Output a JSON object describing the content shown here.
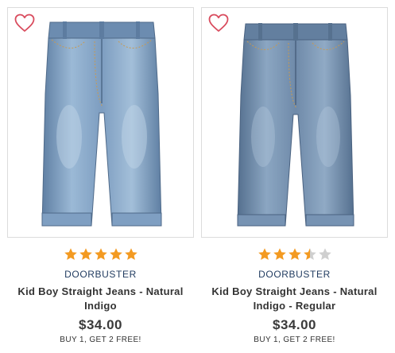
{
  "colors": {
    "heart": "#d94c5e",
    "star_filled": "#f39a21",
    "star_empty": "#cfcfcf",
    "badge_text": "#1f3a5f",
    "denim_light": "#8fb0cf",
    "denim_mid": "#6f8fb3",
    "denim_dark": "#56718f"
  },
  "products": [
    {
      "favorite_icon": "heart-outline-icon",
      "rating": 5,
      "rating_max": 5,
      "badge": "DOORBUSTER",
      "title": "Kid Boy Straight Jeans - Natural Indigo",
      "price": "$34.00",
      "promo": "BUY 1, GET 2 FREE!"
    },
    {
      "favorite_icon": "heart-outline-icon",
      "rating": 3.5,
      "rating_max": 5,
      "badge": "DOORBUSTER",
      "title": "Kid Boy Straight Jeans - Natural Indigo - Regular",
      "price": "$34.00",
      "promo": "BUY 1, GET 2 FREE!"
    }
  ]
}
